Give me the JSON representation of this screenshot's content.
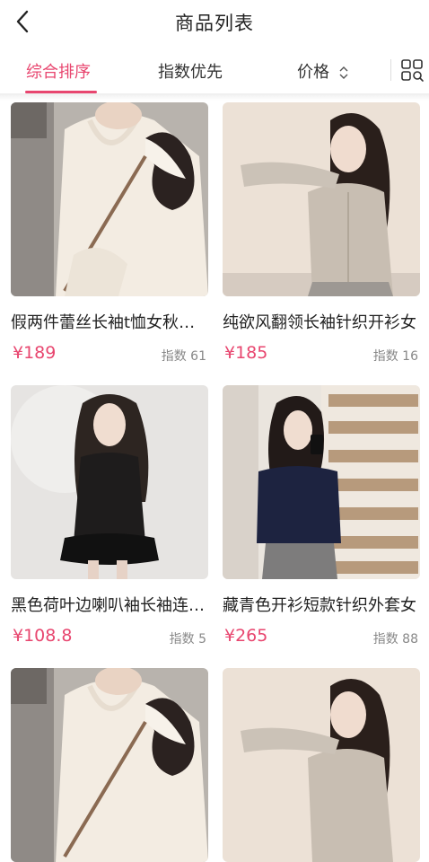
{
  "header": {
    "back_icon": "chevron-left-icon",
    "title": "商品列表"
  },
  "tabs": {
    "items": [
      {
        "label": "综合排序",
        "active": true
      },
      {
        "label": "指数优先",
        "active": false
      },
      {
        "label": "价格",
        "active": false,
        "icon": "sort-updown-icon"
      }
    ],
    "grid_toggle_icon": "grid-view-icon",
    "accent_color": "#e8466f"
  },
  "products": [
    {
      "title": "假两件蕾丝长袖t恤女秋冬内搭打底衫",
      "price": "¥189",
      "index_label": "指数 61",
      "image": "white-lace-top-photo"
    },
    {
      "title": "纯欲风翻领长袖针织开衫女",
      "price": "¥185",
      "index_label": "指数 16",
      "image": "beige-knit-cardigan-photo"
    },
    {
      "title": "黑色荷叶边喇叭袖长袖连衣裙",
      "price": "¥108.8",
      "index_label": "指数 5",
      "image": "black-ruffle-dress-photo"
    },
    {
      "title": "藏青色开衫短款针织外套女",
      "price": "¥265",
      "index_label": "指数 88",
      "image": "navy-cardigan-photo"
    },
    {
      "title": "",
      "price": "",
      "index_label": "",
      "image": "white-lace-top-photo"
    },
    {
      "title": "",
      "price": "",
      "index_label": "",
      "image": "beige-knit-cardigan-photo"
    }
  ]
}
